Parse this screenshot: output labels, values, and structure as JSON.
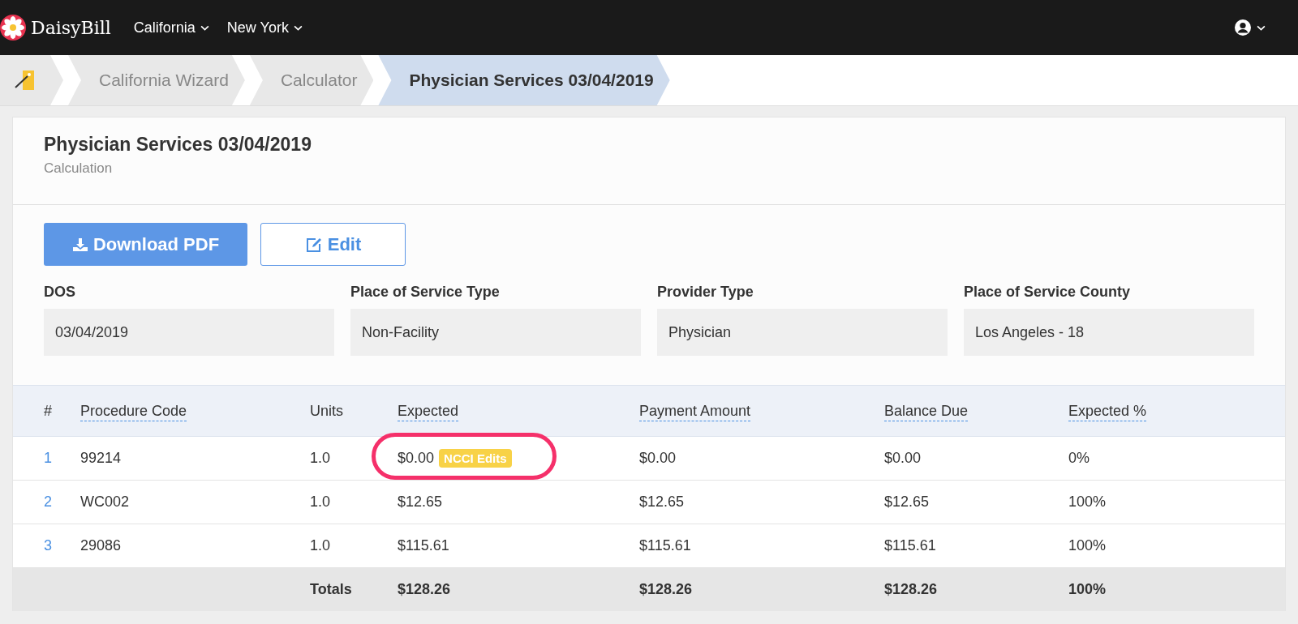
{
  "navbar": {
    "brand": "DaisyBill",
    "menus": [
      {
        "label": "California"
      },
      {
        "label": "New York"
      }
    ]
  },
  "breadcrumb": [
    {
      "label": "California Wizard",
      "selected": false
    },
    {
      "label": "Calculator",
      "selected": false
    },
    {
      "label": "Physician Services 03/04/2019",
      "selected": true
    }
  ],
  "header": {
    "title": "Physician Services 03/04/2019",
    "subtitle": "Calculation"
  },
  "buttons": [
    {
      "label": "Download PDF",
      "kind": "download"
    },
    {
      "label": "Edit",
      "kind": "edit"
    }
  ],
  "fields": [
    {
      "label": "DOS",
      "value": "03/04/2019"
    },
    {
      "label": "Place of Service Type",
      "value": "Non-Facility"
    },
    {
      "label": "Provider Type",
      "value": "Physician"
    },
    {
      "label": "Place of Service County",
      "value": "Los Angeles - 18"
    }
  ],
  "table": {
    "columns": [
      {
        "label": "#",
        "underlined": false
      },
      {
        "label": "Procedure Code",
        "underlined": true
      },
      {
        "label": "Units",
        "underlined": false
      },
      {
        "label": "Expected",
        "underlined": true
      },
      {
        "label": "Payment Amount",
        "underlined": true
      },
      {
        "label": "Balance Due",
        "underlined": true
      },
      {
        "label": "Expected %",
        "underlined": true
      }
    ],
    "rows": [
      {
        "number": "1",
        "code": "99214",
        "units": "1.0",
        "expected": "$0.00",
        "badge": "NCCI Edits",
        "highlighted": true,
        "payment": "$0.00",
        "balance": "$0.00",
        "percent": "0%"
      },
      {
        "number": "2",
        "code": "WC002",
        "units": "1.0",
        "expected": "$12.65",
        "highlighted": false,
        "payment": "$12.65",
        "balance": "$12.65",
        "percent": "100%"
      },
      {
        "number": "3",
        "code": "29086",
        "units": "1.0",
        "expected": "$115.61",
        "highlighted": false,
        "payment": "$115.61",
        "balance": "$115.61",
        "percent": "100%"
      }
    ],
    "totals": {
      "label": "Totals",
      "expected": "$128.26",
      "payment": "$128.26",
      "balance": "$128.26",
      "percent": "100%"
    }
  }
}
